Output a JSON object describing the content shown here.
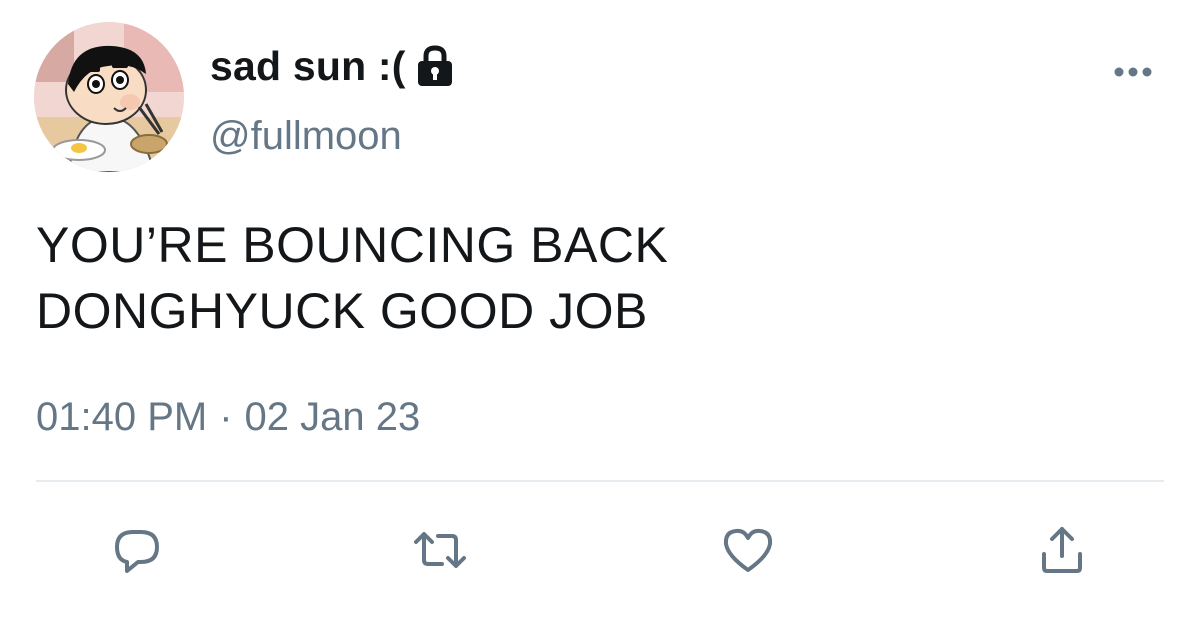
{
  "user": {
    "display_name": "sad sun :(",
    "handle": "@fullmoon",
    "protected_icon": "lock-icon",
    "avatar_icon": "cartoon-avatar"
  },
  "tweet": {
    "lines": [
      "YOU’RE BOUNCING BACK",
      "DONGHYUCK GOOD JOB"
    ],
    "time": "01:40 PM",
    "separator": "·",
    "date": "02 Jan 23"
  },
  "actions": {
    "reply_icon": "reply-icon",
    "retweet_icon": "retweet-icon",
    "like_icon": "heart-icon",
    "share_icon": "share-icon",
    "more_icon": "more-icon"
  },
  "colors": {
    "text_primary": "#14171a",
    "text_secondary": "#657786",
    "icon": "#657786",
    "divider": "#e6ecf0"
  }
}
